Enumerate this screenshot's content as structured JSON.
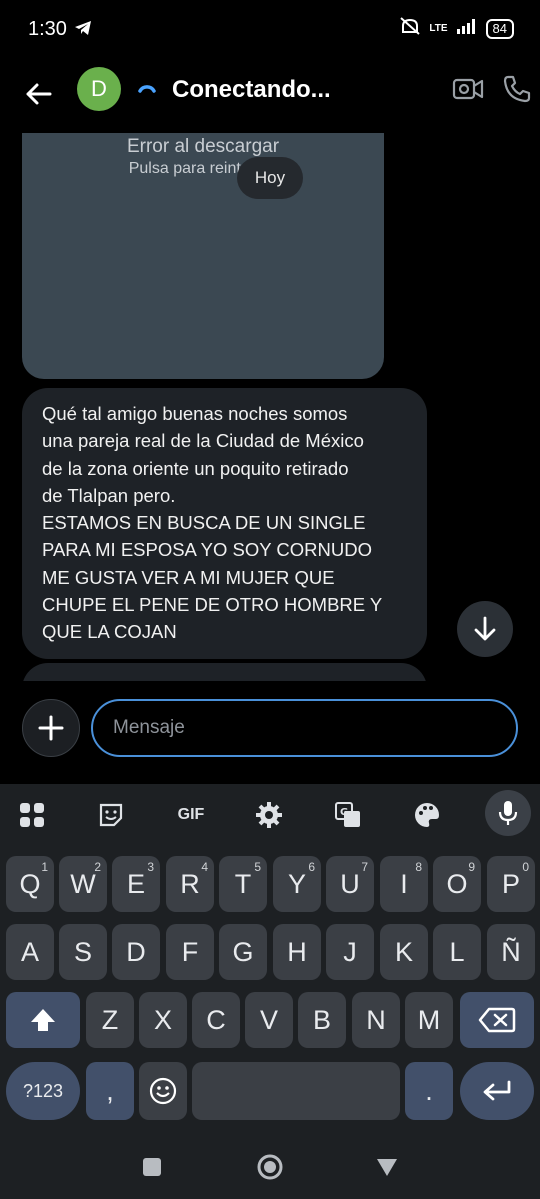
{
  "status_bar": {
    "time": "1:30",
    "network": "LTE",
    "battery": "84"
  },
  "header": {
    "avatar_letter": "D",
    "title": "Conectando..."
  },
  "chat": {
    "image_error_title": "Error al descargar",
    "image_error_subtitle": "Pulsa para reintentar",
    "date_chip": "Hoy",
    "message_text": "Qué tal amigo buenas noches somos\nuna pareja real de la Ciudad de México\nde la zona oriente un poquito retirado\nde Tlalpan pero.\nESTAMOS EN BUSCA DE UN SINGLE\nPARA MI ESPOSA YO SOY CORNUDO\nME GUSTA VER A MI MUJER QUE\nCHUPE EL PENE DE OTRO HOMBRE Y\nQUE LA COJAN"
  },
  "composer": {
    "placeholder": "Mensaje"
  },
  "keyboard": {
    "toolbar": {
      "gif_label": "GIF"
    },
    "row1": [
      {
        "k": "Q",
        "n": "1"
      },
      {
        "k": "W",
        "n": "2"
      },
      {
        "k": "E",
        "n": "3"
      },
      {
        "k": "R",
        "n": "4"
      },
      {
        "k": "T",
        "n": "5"
      },
      {
        "k": "Y",
        "n": "6"
      },
      {
        "k": "U",
        "n": "7"
      },
      {
        "k": "I",
        "n": "8"
      },
      {
        "k": "O",
        "n": "9"
      },
      {
        "k": "P",
        "n": "0"
      }
    ],
    "row2": [
      "A",
      "S",
      "D",
      "F",
      "G",
      "H",
      "J",
      "K",
      "L",
      "Ñ"
    ],
    "row3": [
      "Z",
      "X",
      "C",
      "V",
      "B",
      "N",
      "M"
    ],
    "symbols_label": "?123",
    "comma_label": ",",
    "period_label": "."
  },
  "colors": {
    "accent": "#4a90d9",
    "avatar": "#6ab04c",
    "bubble": "#1e2227"
  }
}
